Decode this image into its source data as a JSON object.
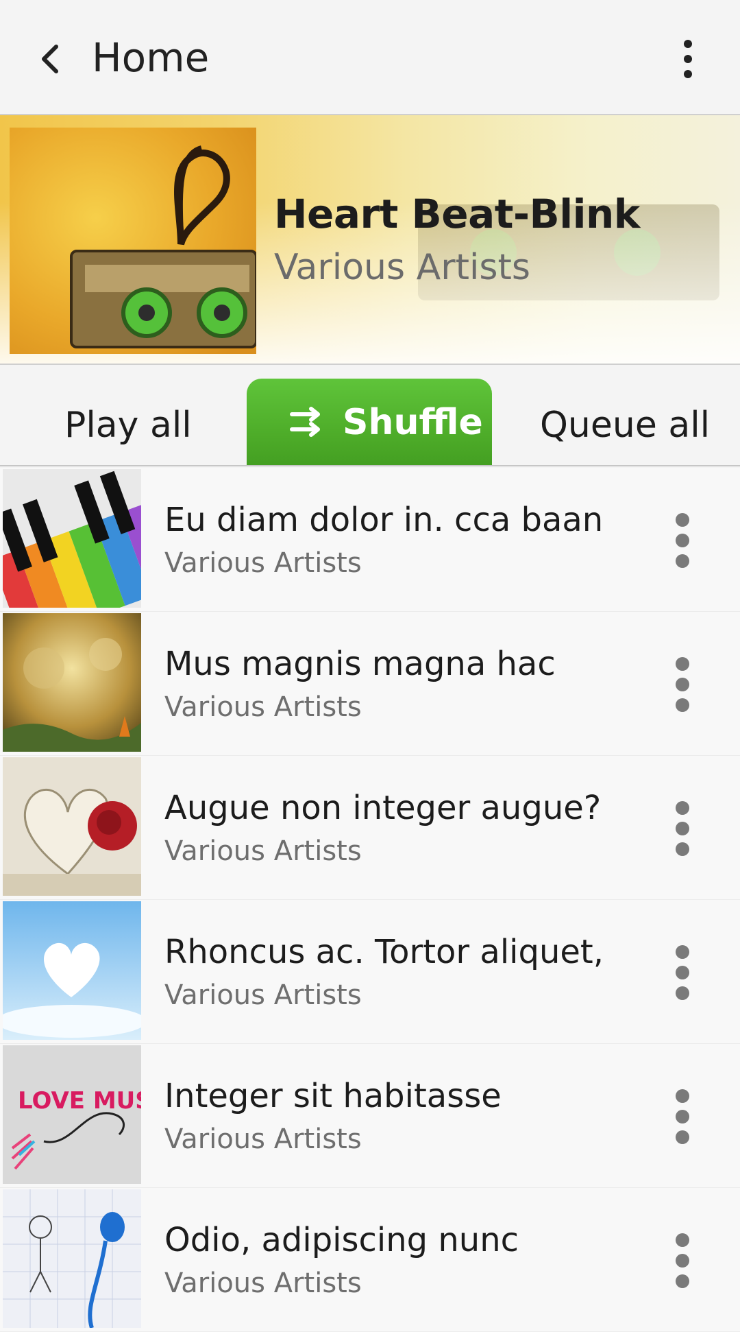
{
  "topbar": {
    "title": "Home",
    "back_icon": "chevron-left-icon",
    "menu_icon": "more-vert-icon"
  },
  "album": {
    "title": "Heart Beat-Blink",
    "artist": "Various Artists",
    "cover": "cassette-heart-cover"
  },
  "actions": {
    "play_all": "Play all",
    "shuffle": "Shuffle",
    "queue_all": "Queue all",
    "accent_color": "#4fae2a"
  },
  "songs": [
    {
      "title": "Eu diam dolor in. cca baan",
      "artist": "Various Artists",
      "art": "piano-keys-art"
    },
    {
      "title": "Mus magnis magna hac",
      "artist": "Various Artists",
      "art": "autumn-leaves-art"
    },
    {
      "title": "Augue non integer augue?",
      "artist": "Various Artists",
      "art": "book-heart-rose-art"
    },
    {
      "title": "Rhoncus ac. Tortor aliquet,",
      "artist": "Various Artists",
      "art": "cloud-heart-art"
    },
    {
      "title": "Integer sit habitasse",
      "artist": "Various Artists",
      "art": "love-music-art",
      "art_text": "LOVE MUSIC"
    },
    {
      "title": "Odio, adipiscing nunc",
      "artist": "Various Artists",
      "art": "earphone-sketch-art"
    }
  ]
}
